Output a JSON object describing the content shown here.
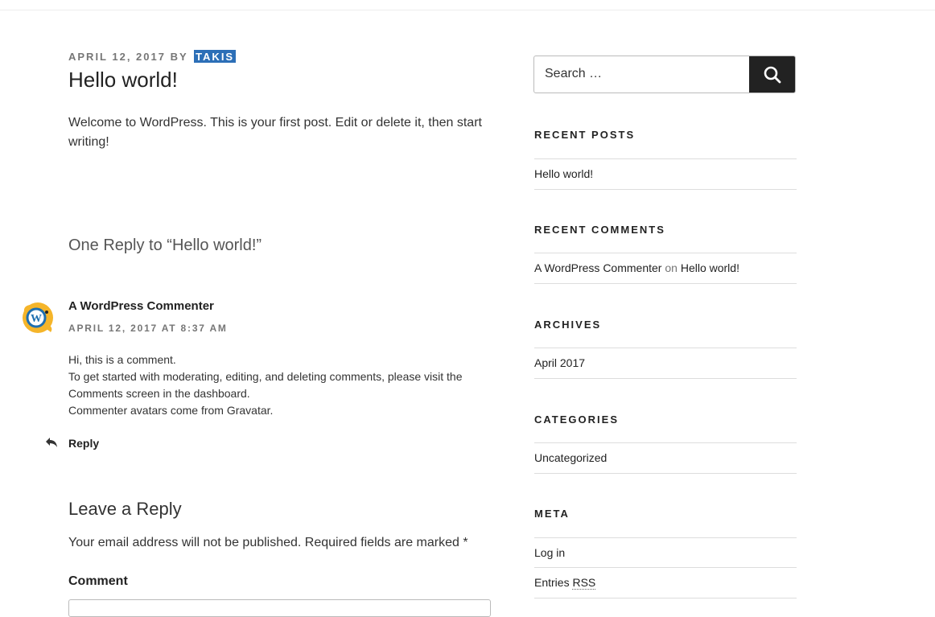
{
  "post": {
    "date": "APRIL 12, 2017",
    "by": "BY",
    "author": "TAKIS",
    "title": "Hello world!",
    "body": "Welcome to WordPress. This is your first post. Edit or delete it, then start writing!"
  },
  "comments": {
    "heading": "One Reply to “Hello world!”",
    "items": [
      {
        "author": "A WordPress Commenter",
        "date": "APRIL 12, 2017 AT 8:37 AM",
        "line1": "Hi, this is a comment.",
        "line2": "To get started with moderating, editing, and deleting comments, please visit the Comments screen in the dashboard.",
        "line3_prefix": "Commenter avatars come from ",
        "line3_link": "Gravatar",
        "line3_suffix": ".",
        "reply_label": "Reply"
      }
    ]
  },
  "reply_form": {
    "title": "Leave a Reply",
    "notes": "Your email address will not be published. Required fields are marked ",
    "required_mark": "*",
    "comment_label": "Comment"
  },
  "sidebar": {
    "search": {
      "placeholder": "Search …",
      "button_label": "Search",
      "icon": "search-icon"
    },
    "recent_posts": {
      "title": "RECENT POSTS",
      "items": [
        "Hello world!"
      ]
    },
    "recent_comments": {
      "title": "RECENT COMMENTS",
      "items": [
        {
          "author": "A WordPress Commenter",
          "on": "on",
          "post": "Hello world!"
        }
      ]
    },
    "archives": {
      "title": "ARCHIVES",
      "items": [
        "April 2017"
      ]
    },
    "categories": {
      "title": "CATEGORIES",
      "items": [
        "Uncategorized"
      ]
    },
    "meta": {
      "title": "META",
      "items": [
        {
          "label": "Log in"
        },
        {
          "prefix": "Entries ",
          "abbr": "RSS"
        }
      ]
    }
  },
  "colors": {
    "author_badge": "#2c6fb7",
    "search_button": "#222222",
    "meta_text": "#767676"
  }
}
